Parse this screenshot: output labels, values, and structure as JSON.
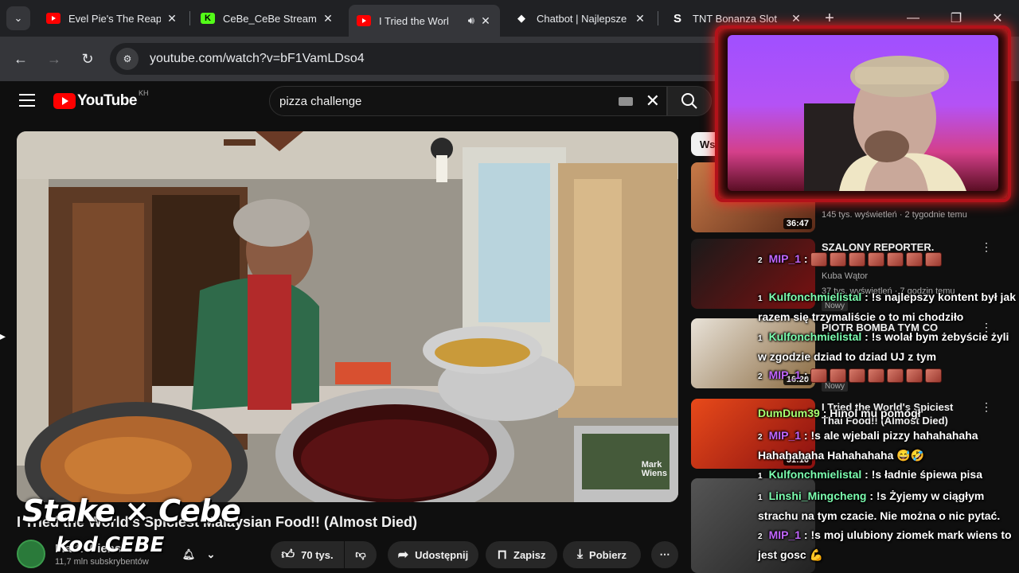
{
  "browser": {
    "tabs": [
      {
        "title": "Evel Pie's The Reape",
        "favicon": "youtube-icon",
        "color": "#ff0000",
        "active": false
      },
      {
        "title": "CeBe_CeBe Stream",
        "favicon": "kick-icon",
        "color": "#53fc18",
        "active": false
      },
      {
        "title": "I Tried the Worl",
        "favicon": "youtube-icon",
        "color": "#ff0000",
        "active": true,
        "audio": true
      },
      {
        "title": "Chatbot | Najlepsze",
        "favicon": "chatbot-icon",
        "color": "#ffffff",
        "active": false
      },
      {
        "title": "TNT Bonanza Slot",
        "favicon": "stake-s-icon",
        "color": "#ffffff",
        "active": false
      }
    ],
    "new_tab": "+",
    "url": "youtube.com/watch?v=bF1VamLDso4"
  },
  "youtube": {
    "logo_text": "YouTube",
    "country_code": "KH",
    "search_query": "pizza challenge"
  },
  "video": {
    "title": "I Tried the World's Spiciest Malaysian Food!! (Almost Died)",
    "watermark": "Mark\nWiens",
    "channel": "Mark Wiens",
    "subscribers": "11,7 mln subskrybentów",
    "likes": "70 tys.",
    "share": "Udostępnij",
    "save": "Zapisz",
    "download": "Pobierz"
  },
  "sidebar": {
    "chip": "Ws",
    "items": [
      {
        "duration": "36:47",
        "title": "",
        "meta": "145 tys. wyświetleń · 2 tygodnie temu",
        "new": ""
      },
      {
        "duration": "",
        "title": "SZALONY REPORTER.",
        "channel": "Kuba Wątor",
        "meta": "37 tys. wyświetleń · 7 godzin temu",
        "new": "Nowy"
      },
      {
        "duration": "16:20",
        "title": "PIOTR BOMBA TYM CO",
        "channel": "",
        "meta": "",
        "new": "Nowy"
      },
      {
        "duration": "51:16",
        "title": "I Tried the World's Spiciest Thai Food!! (Almost Died)",
        "channel": "",
        "meta": "",
        "new": ""
      }
    ]
  },
  "overlay": {
    "brand": "Stake × Cebe",
    "code": "kod CEBE",
    "chat": [
      {
        "level": "2",
        "user": "MIP_1",
        "sep": ":",
        "text": "",
        "emotes": 7
      },
      {
        "level": "1",
        "user": "Kulfonchmielistal",
        "sep": ":",
        "text": "!s najlepszy kontent był jak razem się trzymaliście o to mi chodziło"
      },
      {
        "level": "1",
        "user": "Kulfonchmielistal",
        "sep": ":",
        "text": "!s wolał bym żebyście żyli w zgodzie dziad to dziad UJ z tym"
      },
      {
        "level": "2",
        "user": "MIP_1",
        "sep": ":",
        "text": "",
        "emotes": 7
      },
      {
        "level": "",
        "user": "DumDum39",
        "sep": ":",
        "text": "Hinol mu pomógł"
      },
      {
        "level": "2",
        "user": "MIP_1",
        "sep": ":",
        "text": "!s ale wjebali pizzy hahahahaha Hahahahaha Hahahahaha 😅🤣"
      },
      {
        "level": "1",
        "user": "Kulfonchmielistal",
        "sep": ":",
        "text": "!s ładnie śpiewa pisa"
      },
      {
        "level": "1",
        "user": "Linshi_Mingcheng",
        "sep": ":",
        "text": "!s Żyjemy w ciągłym strachu na tym czacie. Nie można o nic pytać."
      },
      {
        "level": "2",
        "user": "MIP_1",
        "sep": ":",
        "text": "!s moj ulubiony ziomek mark wiens to jest gosc 💪"
      }
    ]
  }
}
